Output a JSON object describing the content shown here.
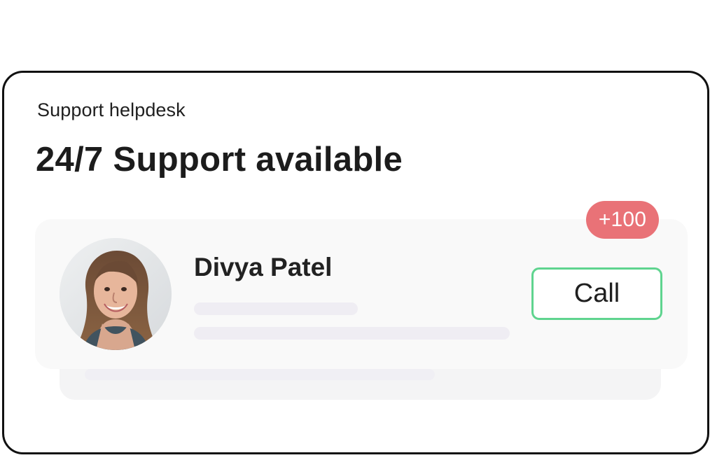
{
  "helpdesk": {
    "subtitle": "Support helpdesk",
    "title": "24/7 Support available"
  },
  "agent": {
    "name": "Divya Patel",
    "avatar_icon": "agent-avatar",
    "call_label": "Call",
    "badge_text": "+100"
  },
  "colors": {
    "call_border": "#5fd48f",
    "badge_background": "#e97277"
  }
}
